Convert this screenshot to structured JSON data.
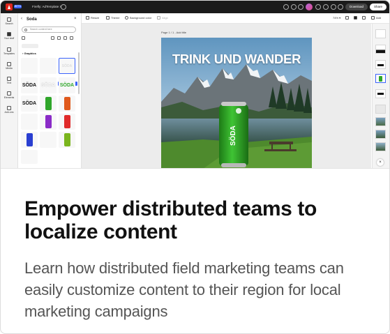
{
  "app": {
    "beta_label": "BETA",
    "tab_title": "Firefly: AdTemplate X",
    "download_label": "Download",
    "share_label": "Share"
  },
  "rail": {
    "items": [
      {
        "label": "Search"
      },
      {
        "label": "Your stuff"
      },
      {
        "label": "Templates"
      },
      {
        "label": "Media"
      },
      {
        "label": "Text"
      },
      {
        "label": "Elements"
      },
      {
        "label": "Add-ons"
      }
    ]
  },
  "panel": {
    "title": "Soda",
    "search_placeholder": "Search content here",
    "section_label": "Graphics",
    "tooltip": "Allow 1 size it",
    "soda_word": "SÖDA"
  },
  "editor_toolbar": {
    "resize_label": "Resize",
    "theme_label": "Theme",
    "background_label": "Background color",
    "align_label": "Align",
    "zoom_label": "74%",
    "add_label": "Add"
  },
  "canvas": {
    "page_label": "Page 1 / 1 - Add title",
    "art_title": "TRINK UND WANDER",
    "can_text": "SÖDA"
  },
  "card": {
    "headline": "Empower distributed teams to localize content",
    "description": "Learn how distributed field marketing teams can easily customize content to their region for local marketing campaigns"
  },
  "colors": {
    "brand_blue": "#3b63fb",
    "soda_green": "#2fa62a",
    "topbar": "#1b1b1b"
  }
}
